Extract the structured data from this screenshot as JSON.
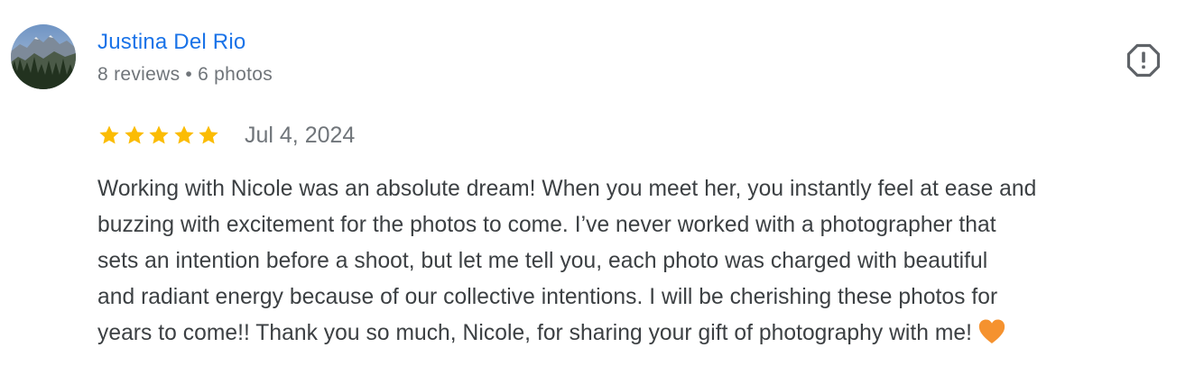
{
  "reviewer": {
    "name": "Justina Del Rio",
    "reviews": "8 reviews",
    "separator": "•",
    "photos": "6 photos"
  },
  "review": {
    "rating": 5,
    "max_rating": 5,
    "date": "Jul 4, 2024",
    "lines": [
      "Working with Nicole was an absolute dream! When you meet her, you instantly feel at ease and",
      "buzzing with excitement for the photos to come. I’ve never worked with a photographer that",
      "sets an intention before a shoot, but let me tell you, each photo was charged with beautiful",
      "and radiant energy because of our collective intentions. I will be cherishing these photos for",
      "years to come!! Thank you so much, Nicole, for sharing your gift of photography with me!"
    ],
    "end_emoji": "orange-heart-icon"
  },
  "colors": {
    "name_link": "#1a73e8",
    "meta_text": "#70757a",
    "body_text": "#3c4043",
    "star": "#fbbc04",
    "heart": "#f5922f",
    "report_icon": "#5f6368"
  }
}
